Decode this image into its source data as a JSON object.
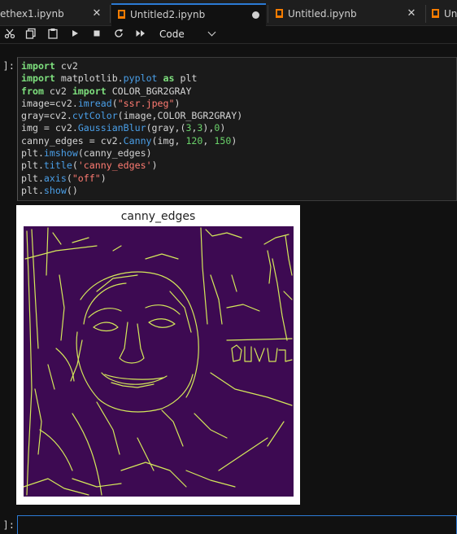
{
  "tabs": [
    {
      "label": "ethex1.ipynb",
      "state": "close"
    },
    {
      "label": "Untitled2.ipynb",
      "state": "modified",
      "active": true
    },
    {
      "label": "Untitled.ipynb",
      "state": "close"
    },
    {
      "label": "Unt",
      "state": "truncated"
    }
  ],
  "toolbar": {
    "cell_type": "Code",
    "icons": [
      "scissors-icon",
      "copy-icon",
      "paste-icon",
      "run-icon",
      "stop-icon",
      "restart-icon",
      "run-all-icon"
    ]
  },
  "cells": [
    {
      "prompt": "]:",
      "code_lines": [
        "import cv2",
        "import matplotlib.pyplot as plt",
        "from cv2 import COLOR_BGR2GRAY",
        "image=cv2.imread(\"ssr.jpeg\")",
        "gray=cv2.cvtColor(image,COLOR_BGR2GRAY)",
        "img = cv2.GaussianBlur(gray,(3,3),0)",
        "canny_edges = cv2.Canny(img, 120, 150)",
        "plt.imshow(canny_edges)",
        "plt.title('canny_edges')",
        "plt.axis(\"off\")",
        "plt.show()"
      ],
      "output_title": "canny_edges"
    },
    {
      "prompt": "]:",
      "code_lines": []
    }
  ],
  "colors": {
    "accent": "#2b7ad4",
    "edge_bg": "#3d0a52",
    "edge_line": "#d4e85a"
  }
}
